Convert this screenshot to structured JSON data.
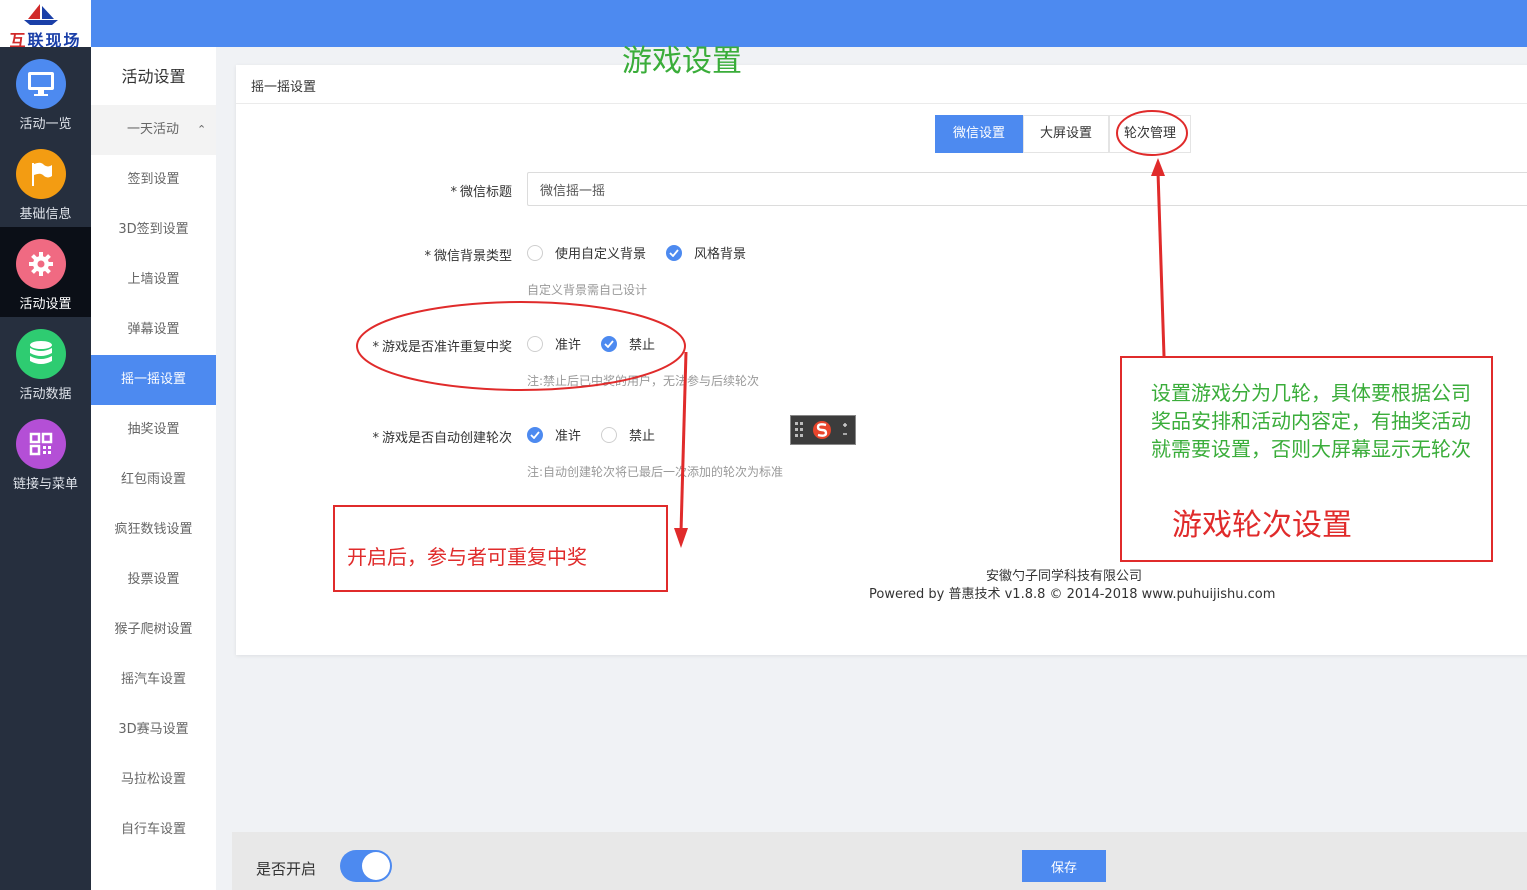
{
  "logo": {
    "text_a": "互",
    "text_b": "联现场"
  },
  "leftnav": {
    "items": [
      {
        "label": "活动一览",
        "icon": "monitor-icon",
        "color": "#4d8af0"
      },
      {
        "label": "基础信息",
        "icon": "flag-icon",
        "color": "#f39c12"
      },
      {
        "label": "活动设置",
        "icon": "gear-icon",
        "color": "#f06a82"
      },
      {
        "label": "活动数据",
        "icon": "database-icon",
        "color": "#2ecc71"
      },
      {
        "label": "链接与菜单",
        "icon": "qrcode-icon",
        "color": "#b44fd6"
      }
    ]
  },
  "subnav": {
    "title": "活动设置",
    "group_label": "一天活动",
    "group_chevron": "⌃",
    "items": [
      "签到设置",
      "3D签到设置",
      "上墙设置",
      "弹幕设置",
      "摇一摇设置",
      "抽奖设置",
      "红包雨设置",
      "疯狂数钱设置",
      "投票设置",
      "猴子爬树设置",
      "摇汽车设置",
      "3D赛马设置",
      "马拉松设置",
      "自行车设置"
    ]
  },
  "card": {
    "title": "摇一摇设置",
    "tabs": [
      "微信设置",
      "大屏设置",
      "轮次管理"
    ],
    "form": {
      "star": "*",
      "title_label": "微信标题",
      "title_value": "微信摇一摇",
      "bg_label": "微信背景类型",
      "bg_options": [
        "使用自定义背景",
        "风格背景"
      ],
      "bg_hint": "自定义背景需自己设计",
      "repeat_label": "游戏是否准许重复中奖",
      "repeat_options": [
        "准许",
        "禁止"
      ],
      "repeat_hint": "注:禁止后已中奖的用户，无法参与后续轮次",
      "auto_label": "游戏是否自动创建轮次",
      "auto_options": [
        "准许",
        "禁止"
      ],
      "auto_hint": "注:自动创建轮次将已最后一次添加的轮次为标准"
    },
    "footer": {
      "company": "安徽勺子同学科技有限公司",
      "powered": "Powered by 普惠技术 v1.8.8 © 2014-2018 www.puhuijishu.com"
    }
  },
  "bottombar": {
    "enable_label": "是否开启",
    "save_label": "保存"
  },
  "annotations": {
    "title": "游戏设置",
    "repeat_note": "开启后，参与者可重复中奖",
    "rounds_note_lines": [
      "设置游戏分为几轮，具体要根据公司",
      "奖品安排和活动内容定，有抽奖活动",
      "就需要设置，否则大屏幕显示无轮次"
    ],
    "rounds_title": "游戏轮次设置"
  }
}
